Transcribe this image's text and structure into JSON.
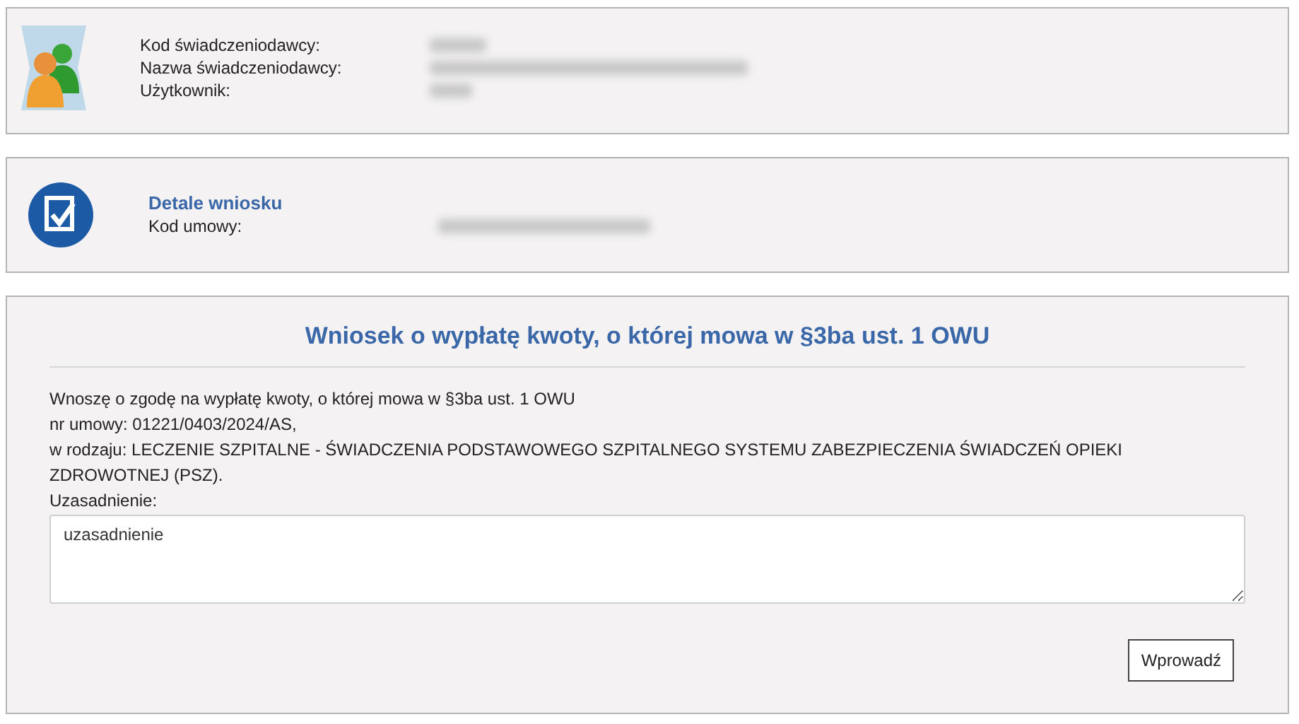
{
  "provider_panel": {
    "fields": [
      {
        "label": "Kod świadczeniodawcy:"
      },
      {
        "label": "Nazwa świadczeniodawcy:"
      },
      {
        "label": "Użytkownik:"
      }
    ]
  },
  "details_panel": {
    "title": "Detale wniosku",
    "fields": [
      {
        "label": "Kod umowy:"
      }
    ]
  },
  "request_form": {
    "heading": "Wniosek o wypłatę kwoty, o której mowa w §3ba ust. 1 OWU",
    "lines": [
      "Wnoszę o zgodę na wypłatę kwoty, o której mowa w §3ba ust. 1 OWU",
      "nr umowy: 01221/0403/2024/AS,",
      "w rodzaju: LECZENIE SZPITALNE - ŚWIADCZENIA PODSTAWOWEGO SZPITALNEGO SYSTEMU ZABEZPIECZENIA ŚWIADCZEŃ OPIEKI ZDROWOTNEJ (PSZ)."
    ],
    "justification_label": "Uzasadnienie:",
    "justification_value": "uzasadnienie",
    "submit_button": "Wprowadź"
  }
}
